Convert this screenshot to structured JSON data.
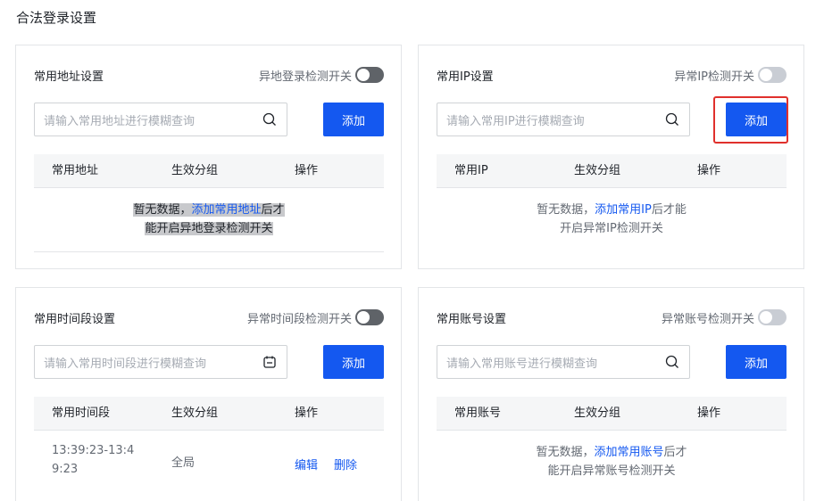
{
  "page": {
    "title": "合法登录设置"
  },
  "colors": {
    "accent": "#1458f0",
    "highlight": "#e0302c"
  },
  "address_card": {
    "title": "常用地址设置",
    "switch_label": "异地登录检测开关",
    "switch_on": true,
    "search_placeholder": "请输入常用地址进行模糊查询",
    "search_icon": "search-icon",
    "add_label": "添加",
    "columns": [
      "常用地址",
      "生效分组",
      "操作"
    ],
    "empty": {
      "before": "暂无数据，",
      "link": "添加常用地址",
      "after1": "后才",
      "after2": "能开启异地登录检测开关"
    }
  },
  "ip_card": {
    "title": "常用IP设置",
    "switch_label": "异常IP检测开关",
    "switch_on": false,
    "search_placeholder": "请输入常用IP进行模糊查询",
    "search_icon": "search-icon",
    "add_label": "添加",
    "columns": [
      "常用IP",
      "生效分组",
      "操作"
    ],
    "empty": {
      "before": "暂无数据，",
      "link": "添加常用IP",
      "after1": "后才能",
      "after2": "开启异常IP检测开关"
    }
  },
  "time_card": {
    "title": "常用时间段设置",
    "switch_label": "异常时间段检测开关",
    "switch_on": true,
    "search_placeholder": "请输入常用时间段进行模糊查询",
    "search_icon": "calendar-icon",
    "add_label": "添加",
    "columns": [
      "常用时间段",
      "生效分组",
      "操作"
    ],
    "rows": [
      {
        "time_line1": "13:39:23-13:4",
        "time_line2": "9:23",
        "group": "全局",
        "edit": "编辑",
        "delete": "删除"
      }
    ]
  },
  "account_card": {
    "title": "常用账号设置",
    "switch_label": "异常账号检测开关",
    "switch_on": false,
    "search_placeholder": "请输入常用账号进行模糊查询",
    "search_icon": "search-icon",
    "add_label": "添加",
    "columns": [
      "常用账号",
      "生效分组",
      "操作"
    ],
    "empty": {
      "before": "暂无数据，",
      "link": "添加常用账号",
      "after1": "后才",
      "after2": "能开启异常账号检测开关"
    }
  }
}
